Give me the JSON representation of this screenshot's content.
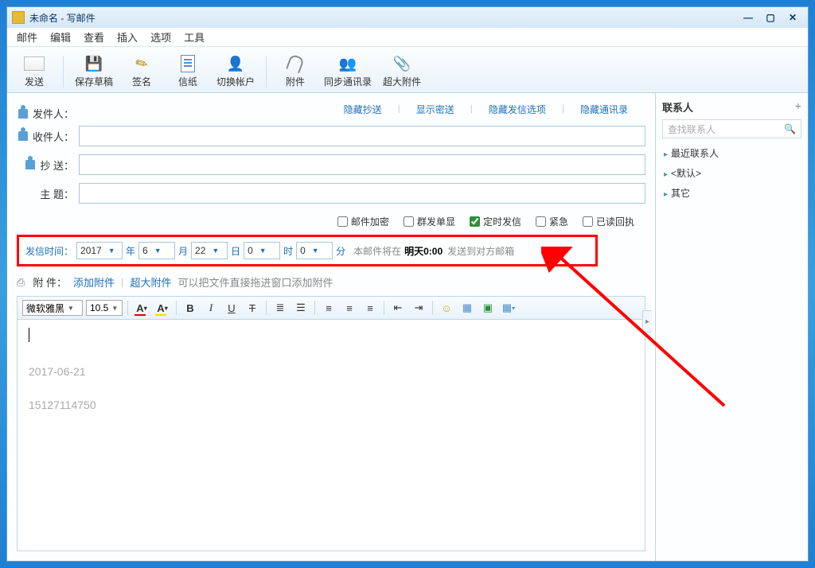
{
  "titlebar": {
    "title": "未命名 - 写邮件"
  },
  "menu": {
    "mail": "邮件",
    "edit": "编辑",
    "view": "查看",
    "insert": "插入",
    "options": "选项",
    "tools": "工具"
  },
  "toolbar": {
    "send": "发送",
    "save_draft": "保存草稿",
    "sign": "签名",
    "paper": "信纸",
    "switch": "切换帐户",
    "attach": "附件",
    "sync": "同步通讯录",
    "big_attach": "超大附件"
  },
  "header_links": {
    "hide_cc": "隐藏抄送",
    "show_bcc": "显示密送",
    "hide_send_opts": "隐藏发信选项",
    "hide_contacts": "隐藏通讯录",
    "sep": "|"
  },
  "fields": {
    "from": "发件人：",
    "to": "收件人：",
    "cc": "抄  送：",
    "subject": "主  题："
  },
  "checkboxes": {
    "encrypt": "邮件加密",
    "mass": "群发单显",
    "scheduled": "定时发信",
    "urgent": "紧急",
    "receipt": "已读回执"
  },
  "schedule": {
    "label": "发信时间：",
    "year": "2017",
    "year_u": "年",
    "month": "6",
    "month_u": "月",
    "day": "22",
    "day_u": "日",
    "hour": "0",
    "hour_u": "时",
    "minute": "0",
    "minute_u": "分",
    "hint_pre": "本邮件将在",
    "hint_bold": "明天0:00",
    "hint_post": "发送到对方邮箱"
  },
  "attach_row": {
    "label": "附  件：",
    "add": "添加附件",
    "big": "超大附件",
    "hint": "可以把文件直接拖进窗口添加附件"
  },
  "editor_tb": {
    "font": "微软雅黑",
    "size": "10.5",
    "a": "A",
    "bold": "B",
    "italic": "I",
    "underline": "U",
    "strike": "T"
  },
  "editor_body": {
    "line1": "2017-06-21",
    "line2": "15127114750"
  },
  "contacts": {
    "title": "联系人",
    "search_placeholder": "查找联系人",
    "items": [
      "最近联系人",
      "<默认>",
      "其它"
    ]
  }
}
